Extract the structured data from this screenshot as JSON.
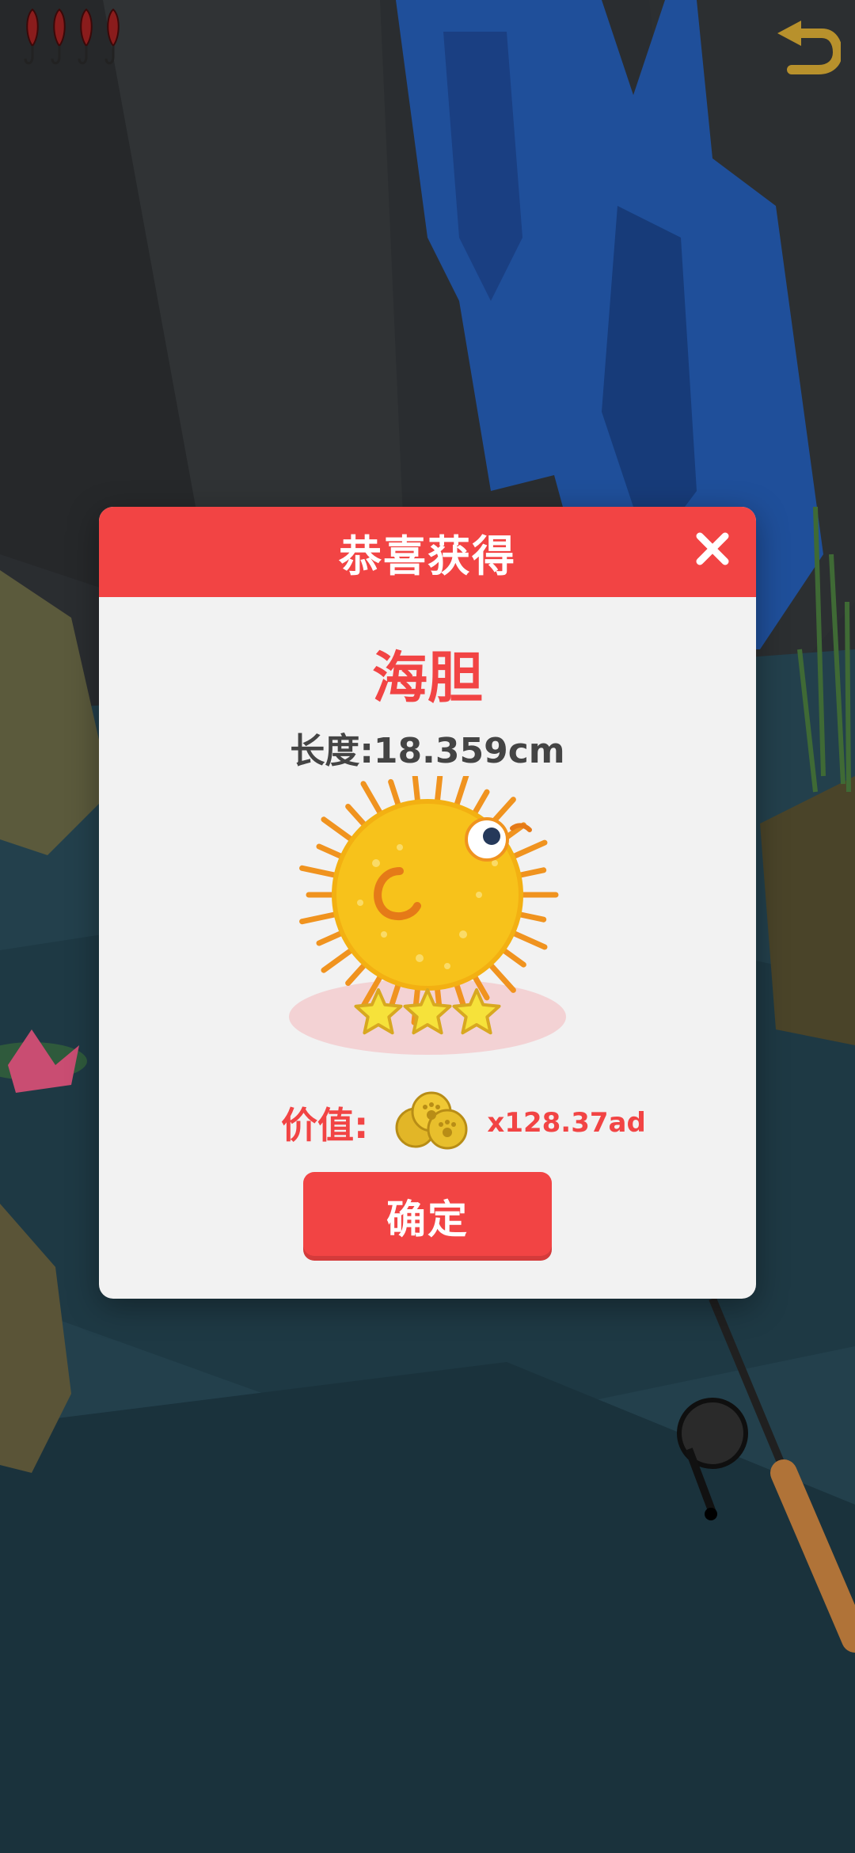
{
  "hud": {
    "bait_count": 4,
    "back_icon": "undo-arrow-icon"
  },
  "dialog": {
    "title": "恭喜获得",
    "close_icon": "close-icon",
    "fish_name": "海胆",
    "length_text": "长度:18.359cm",
    "rating_stars": 3,
    "value_label": "价值:",
    "value_amount": "x128.37ad",
    "confirm_label": "确定"
  },
  "colors": {
    "accent_red": "#f24444",
    "fish_yellow": "#f7c21b",
    "spike_orange": "#f0931f",
    "gold_coin": "#e2b627"
  }
}
